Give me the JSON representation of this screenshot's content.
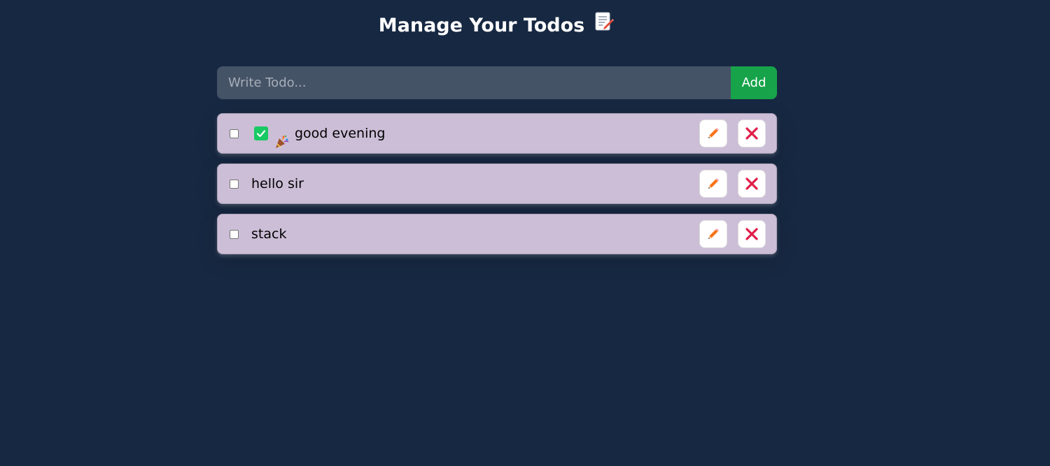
{
  "header": {
    "title": "Manage Your Todos",
    "title_emoji_icon": "memo-icon"
  },
  "form": {
    "input_placeholder": "Write Todo...",
    "input_value": "",
    "add_label": "Add"
  },
  "todos": [
    {
      "text": "good evening",
      "completed": false,
      "prefix_icons": [
        "check-mark-button-icon",
        "party-popper-icon"
      ]
    },
    {
      "text": "hello sir",
      "completed": false,
      "prefix_icons": []
    },
    {
      "text": "stack",
      "completed": false,
      "prefix_icons": []
    }
  ],
  "icons": {
    "edit": "pencil-icon",
    "delete": "cross-mark-icon"
  },
  "colors": {
    "background": "#172842",
    "todo_bg": "#ccbed7",
    "add_button": "#17a34a",
    "pencil": "#f97316",
    "cross": "#e11d48"
  }
}
